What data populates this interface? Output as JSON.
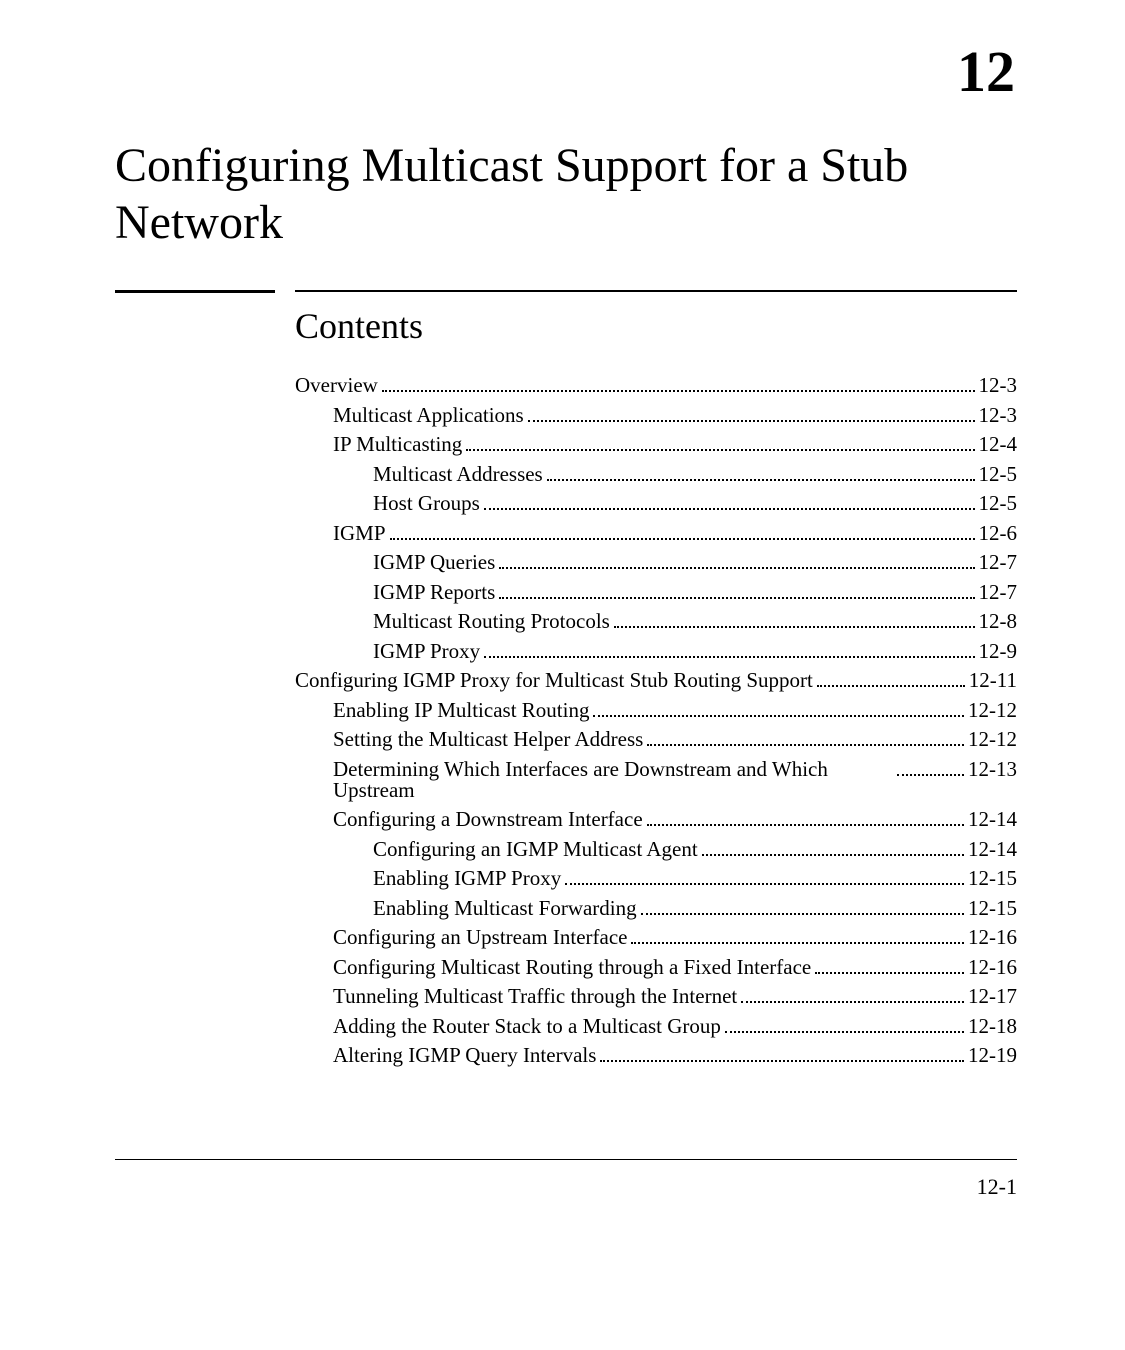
{
  "chapter_number": "12",
  "title": "Configuring Multicast Support for a Stub Network",
  "contents_heading": "Contents",
  "page_footer": "12-1",
  "toc": [
    {
      "level": 0,
      "label": "Overview",
      "page": "12-3"
    },
    {
      "level": 1,
      "label": "Multicast Applications",
      "page": "12-3"
    },
    {
      "level": 1,
      "label": "IP Multicasting",
      "page": "12-4"
    },
    {
      "level": 2,
      "label": "Multicast Addresses",
      "page": "12-5"
    },
    {
      "level": 2,
      "label": "Host Groups",
      "page": "12-5"
    },
    {
      "level": 1,
      "label": "IGMP",
      "page": "12-6"
    },
    {
      "level": 2,
      "label": "IGMP Queries",
      "page": "12-7"
    },
    {
      "level": 2,
      "label": "IGMP Reports",
      "page": "12-7"
    },
    {
      "level": 2,
      "label": "Multicast Routing Protocols",
      "page": "12-8"
    },
    {
      "level": 2,
      "label": "IGMP Proxy",
      "page": "12-9"
    },
    {
      "level": 0,
      "label": "Configuring IGMP Proxy for Multicast Stub Routing Support",
      "page": "12-11"
    },
    {
      "level": 1,
      "label": "Enabling IP Multicast Routing",
      "page": "12-12"
    },
    {
      "level": 1,
      "label": "Setting the Multicast Helper Address",
      "page": "12-12"
    },
    {
      "level": 1,
      "label": "Determining Which Interfaces are Downstream and Which Upstream",
      "page": "12-13",
      "wrap": true
    },
    {
      "level": 1,
      "label": "Configuring a Downstream Interface",
      "page": "12-14"
    },
    {
      "level": 2,
      "label": "Configuring an IGMP Multicast Agent",
      "page": "12-14"
    },
    {
      "level": 2,
      "label": "Enabling IGMP Proxy",
      "page": "12-15"
    },
    {
      "level": 2,
      "label": "Enabling Multicast Forwarding",
      "page": "12-15"
    },
    {
      "level": 1,
      "label": "Configuring an Upstream Interface",
      "page": "12-16"
    },
    {
      "level": 1,
      "label": "Configuring Multicast Routing through a Fixed Interface",
      "page": "12-16"
    },
    {
      "level": 1,
      "label": "Tunneling Multicast Traffic through the Internet",
      "page": "12-17"
    },
    {
      "level": 1,
      "label": "Adding the Router Stack to a Multicast Group",
      "page": "12-18"
    },
    {
      "level": 1,
      "label": "Altering IGMP Query Intervals",
      "page": "12-19"
    }
  ]
}
